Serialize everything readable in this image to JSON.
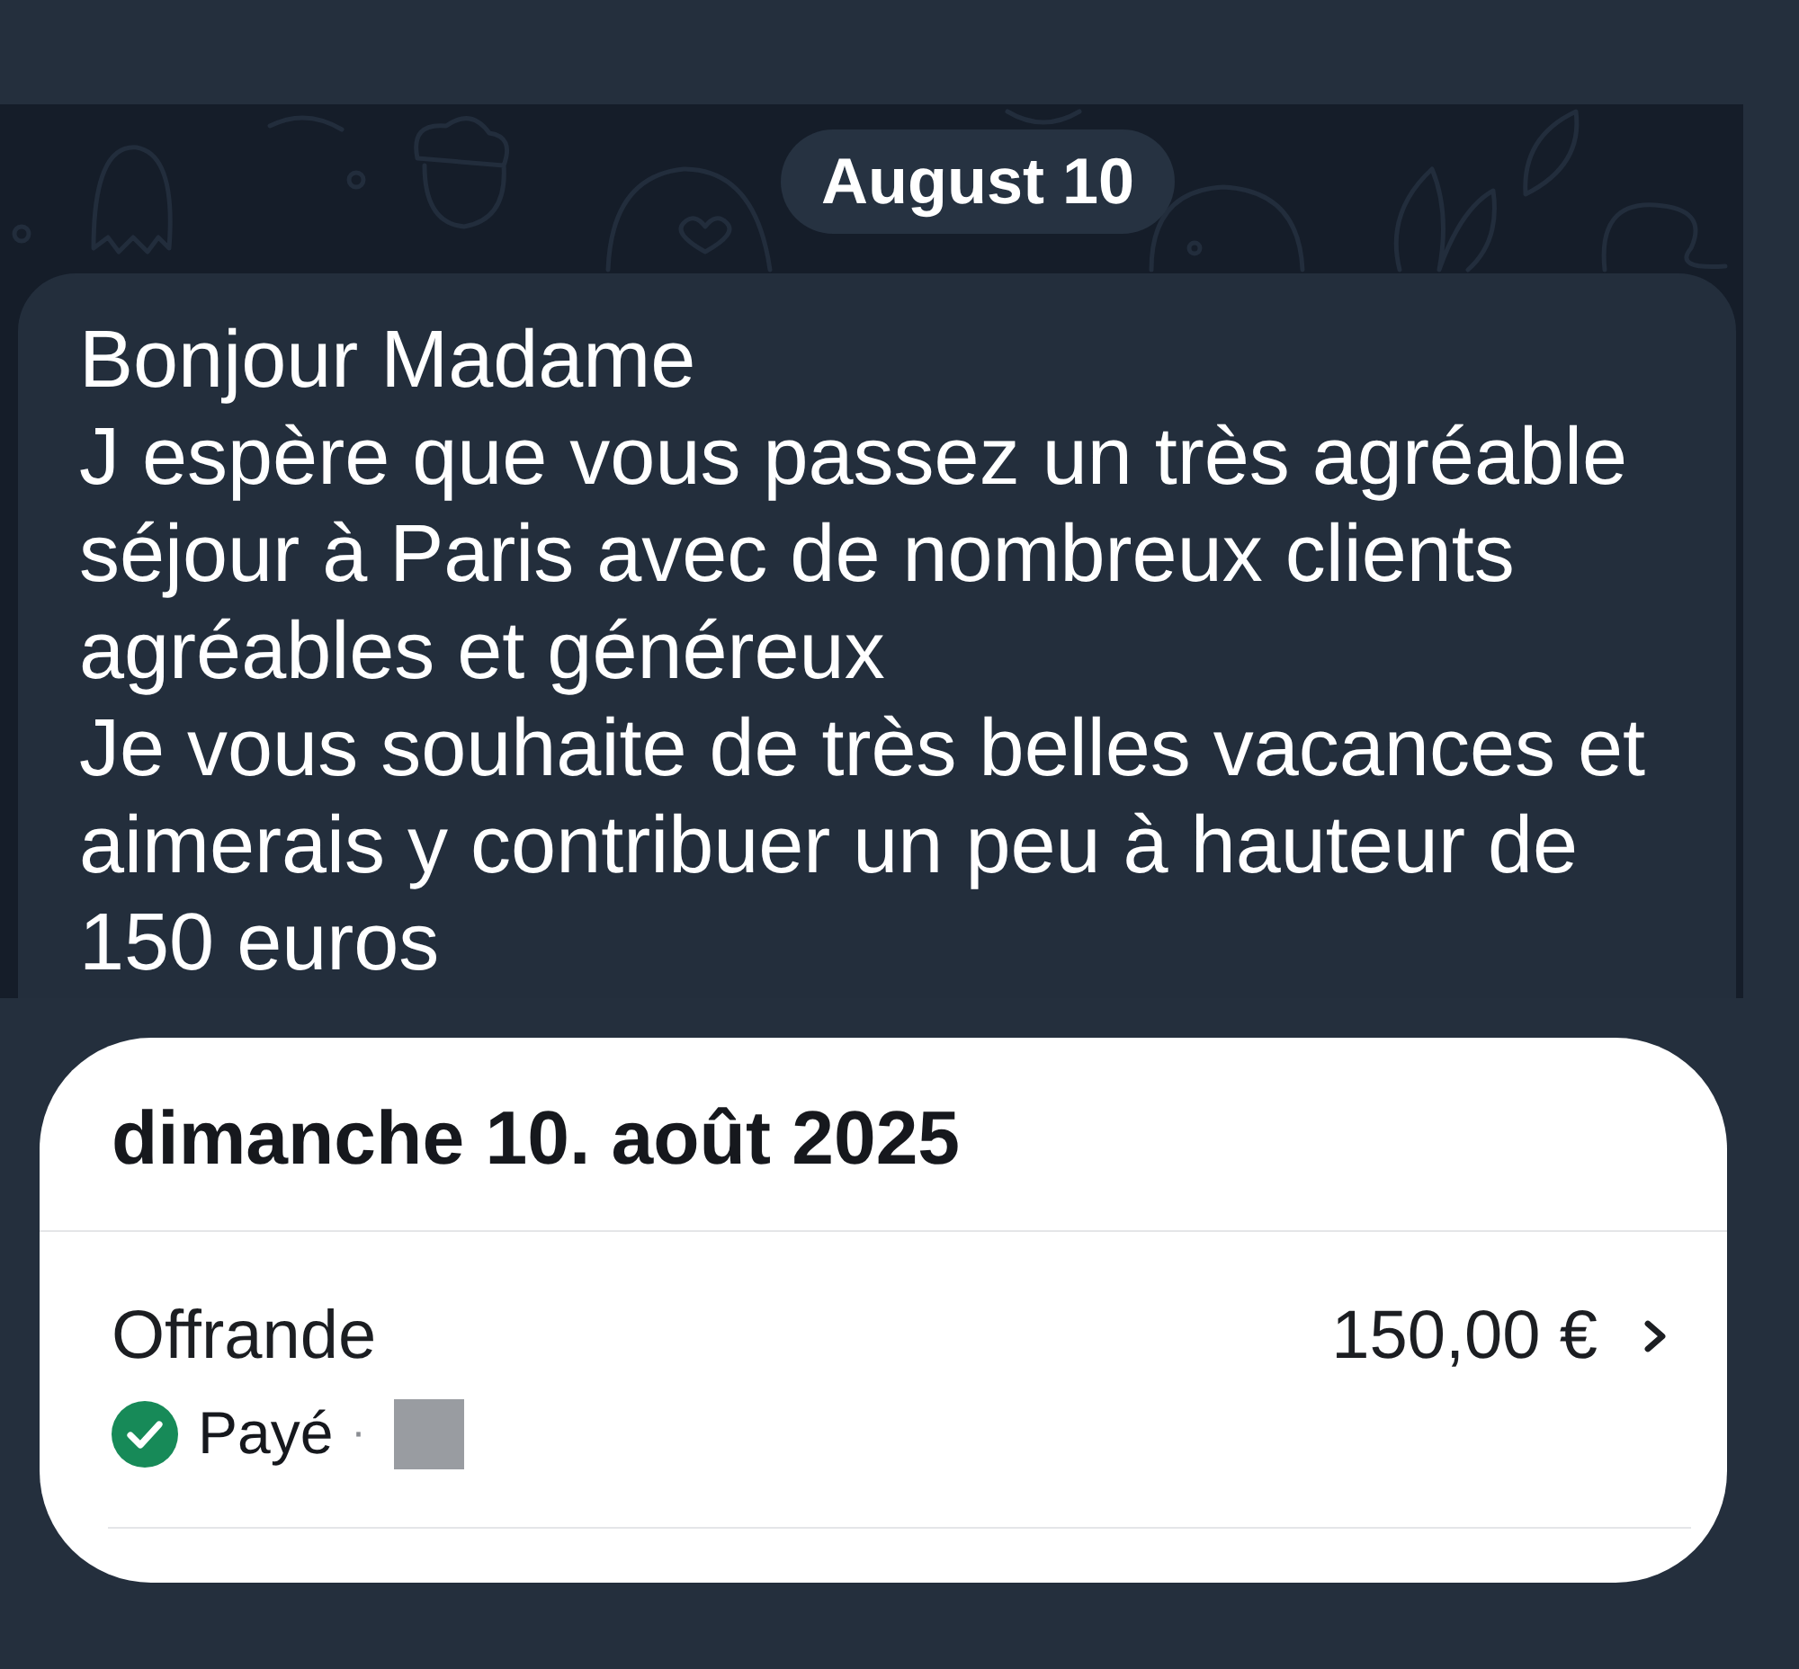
{
  "chat": {
    "date_pill": "August 10",
    "message": {
      "text": "Bonjour Madame\nJ espère que vous passez un très agréable séjour à Paris avec de nombreux clients agréables et généreux\nJe vous souhaite de très belles vacances et aimerais y contribuer un peu à hauteur de 150 euros"
    }
  },
  "payment_card": {
    "date": "dimanche 10. août 2025",
    "transaction": {
      "label": "Offrande",
      "amount": "150,00 €",
      "status": {
        "label": "Payé",
        "paid": true
      },
      "separator": "·"
    }
  }
}
